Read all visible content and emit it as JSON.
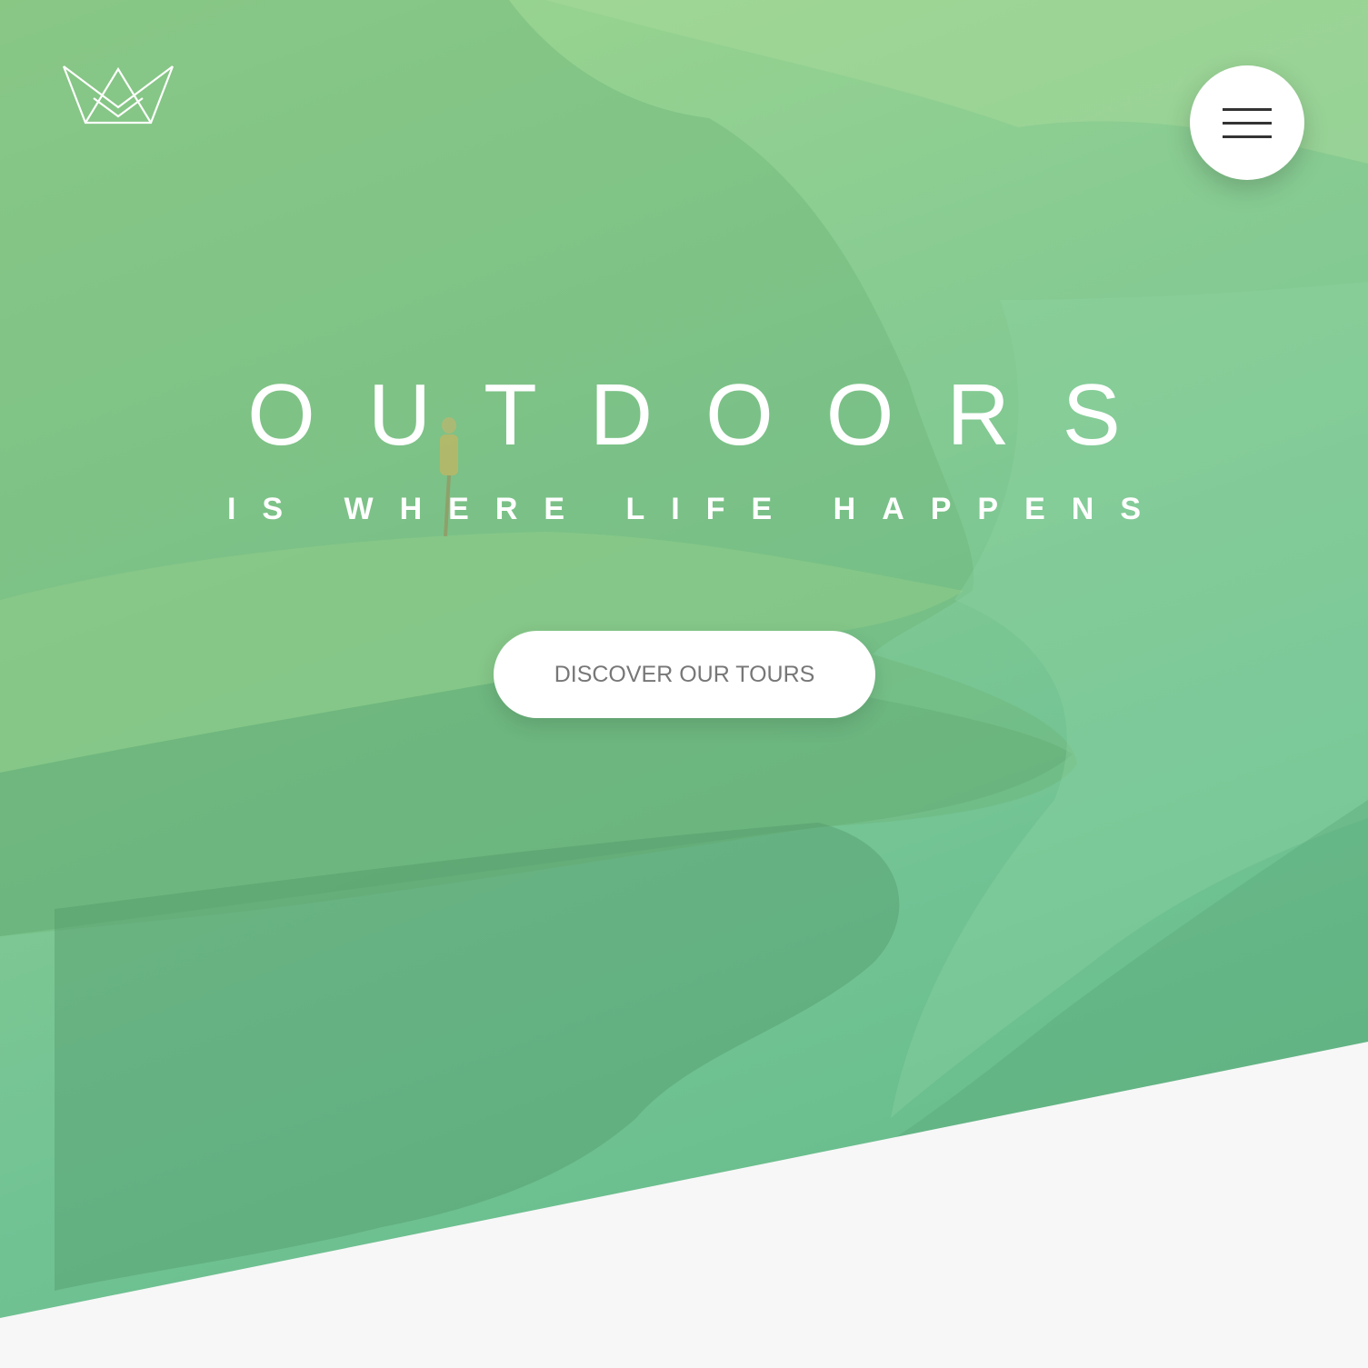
{
  "header": {
    "logo_icon": "crown-logo-icon",
    "menu_icon": "hamburger-menu-icon"
  },
  "hero": {
    "title": "OUTDOORS",
    "subtitle": "IS WHERE LIFE HAPPENS",
    "cta_label": "DISCOVER OUR TOURS",
    "overlay_colors": [
      "#9ed68f",
      "#5fb784"
    ]
  },
  "colors": {
    "background": "#f7f7f7",
    "button_text": "#777777",
    "white": "#ffffff"
  }
}
